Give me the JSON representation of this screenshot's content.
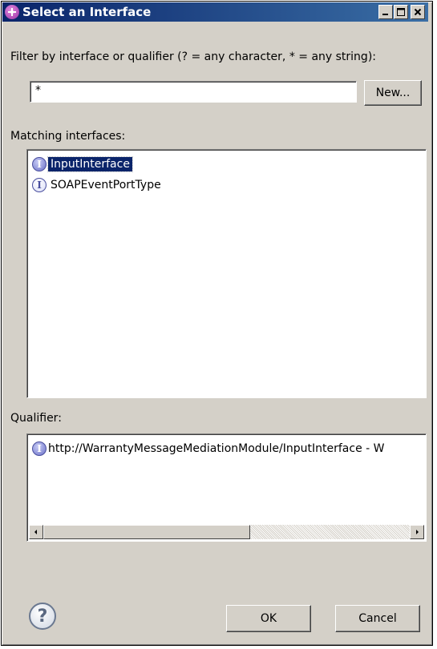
{
  "window": {
    "title": "Select an Interface",
    "controls": [
      "minimize",
      "maximize",
      "close"
    ]
  },
  "filter": {
    "label": "Filter by interface or qualifier (? = any character, * = any string):",
    "value": "*",
    "new_button": "New..."
  },
  "matching": {
    "label": "Matching interfaces:",
    "items": [
      {
        "label": "InputInterface",
        "selected": true,
        "icon": "interface-icon"
      },
      {
        "label": "SOAPEventPortType",
        "selected": false,
        "icon": "interface-icon"
      }
    ]
  },
  "qualifier": {
    "label": "Qualifier:",
    "items": [
      {
        "label": "http://WarrantyMessageMediationModule/InputInterface - W",
        "icon": "interface-icon"
      }
    ]
  },
  "buttons": {
    "ok": "OK",
    "cancel": "Cancel",
    "help": "?"
  },
  "colors": {
    "title_bar": "#0a246a",
    "selection": "#0a246a",
    "dialog_bg": "#d4d0c8"
  }
}
